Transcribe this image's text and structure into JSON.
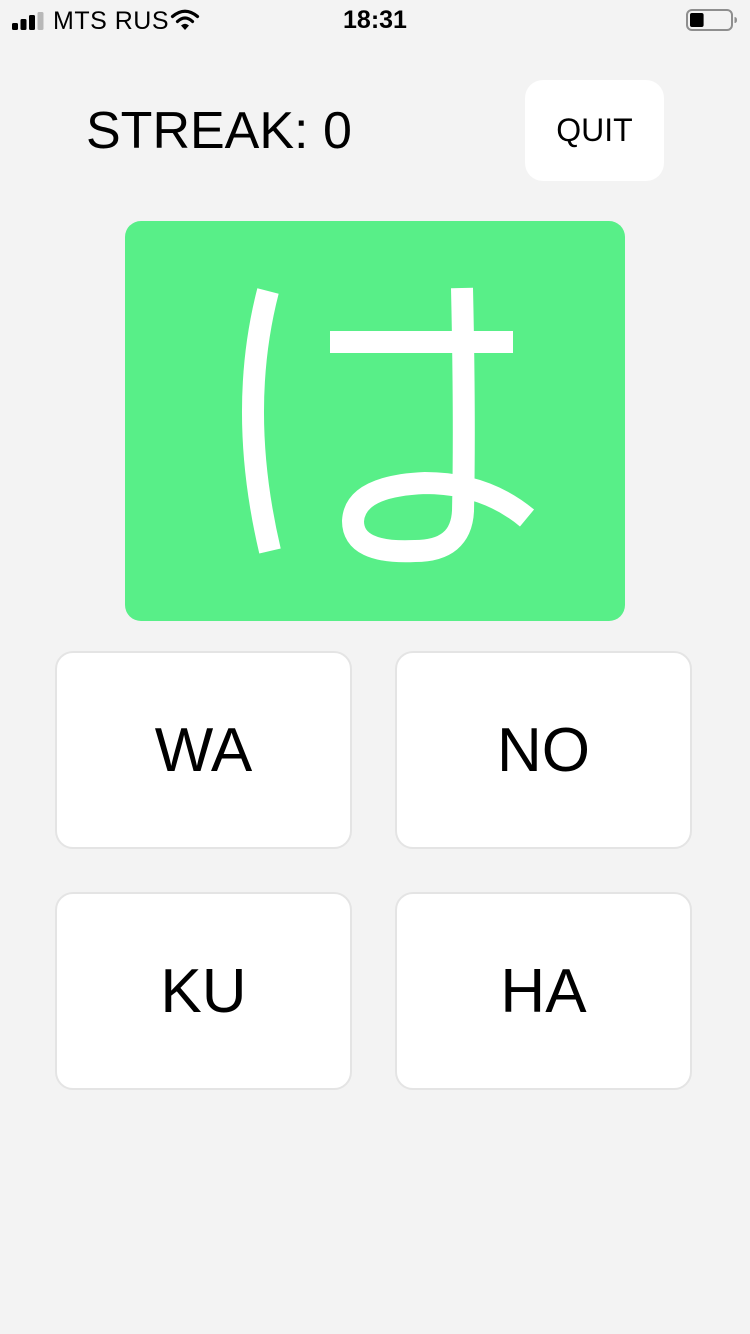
{
  "status_bar": {
    "carrier": "MTS RUS",
    "time": "18:31",
    "signal_icon": "cellular-signal-icon",
    "wifi_icon": "wifi-icon",
    "battery_icon": "battery-icon",
    "battery_level": 0.35
  },
  "header": {
    "streak_label": "STREAK: 0",
    "quit_label": "QUIT"
  },
  "card": {
    "kana": "は",
    "background_color": "#58ef88",
    "glyph_color": "#ffffff"
  },
  "answers": [
    {
      "label": "WA"
    },
    {
      "label": "NO"
    },
    {
      "label": "KU"
    },
    {
      "label": "HA"
    }
  ]
}
